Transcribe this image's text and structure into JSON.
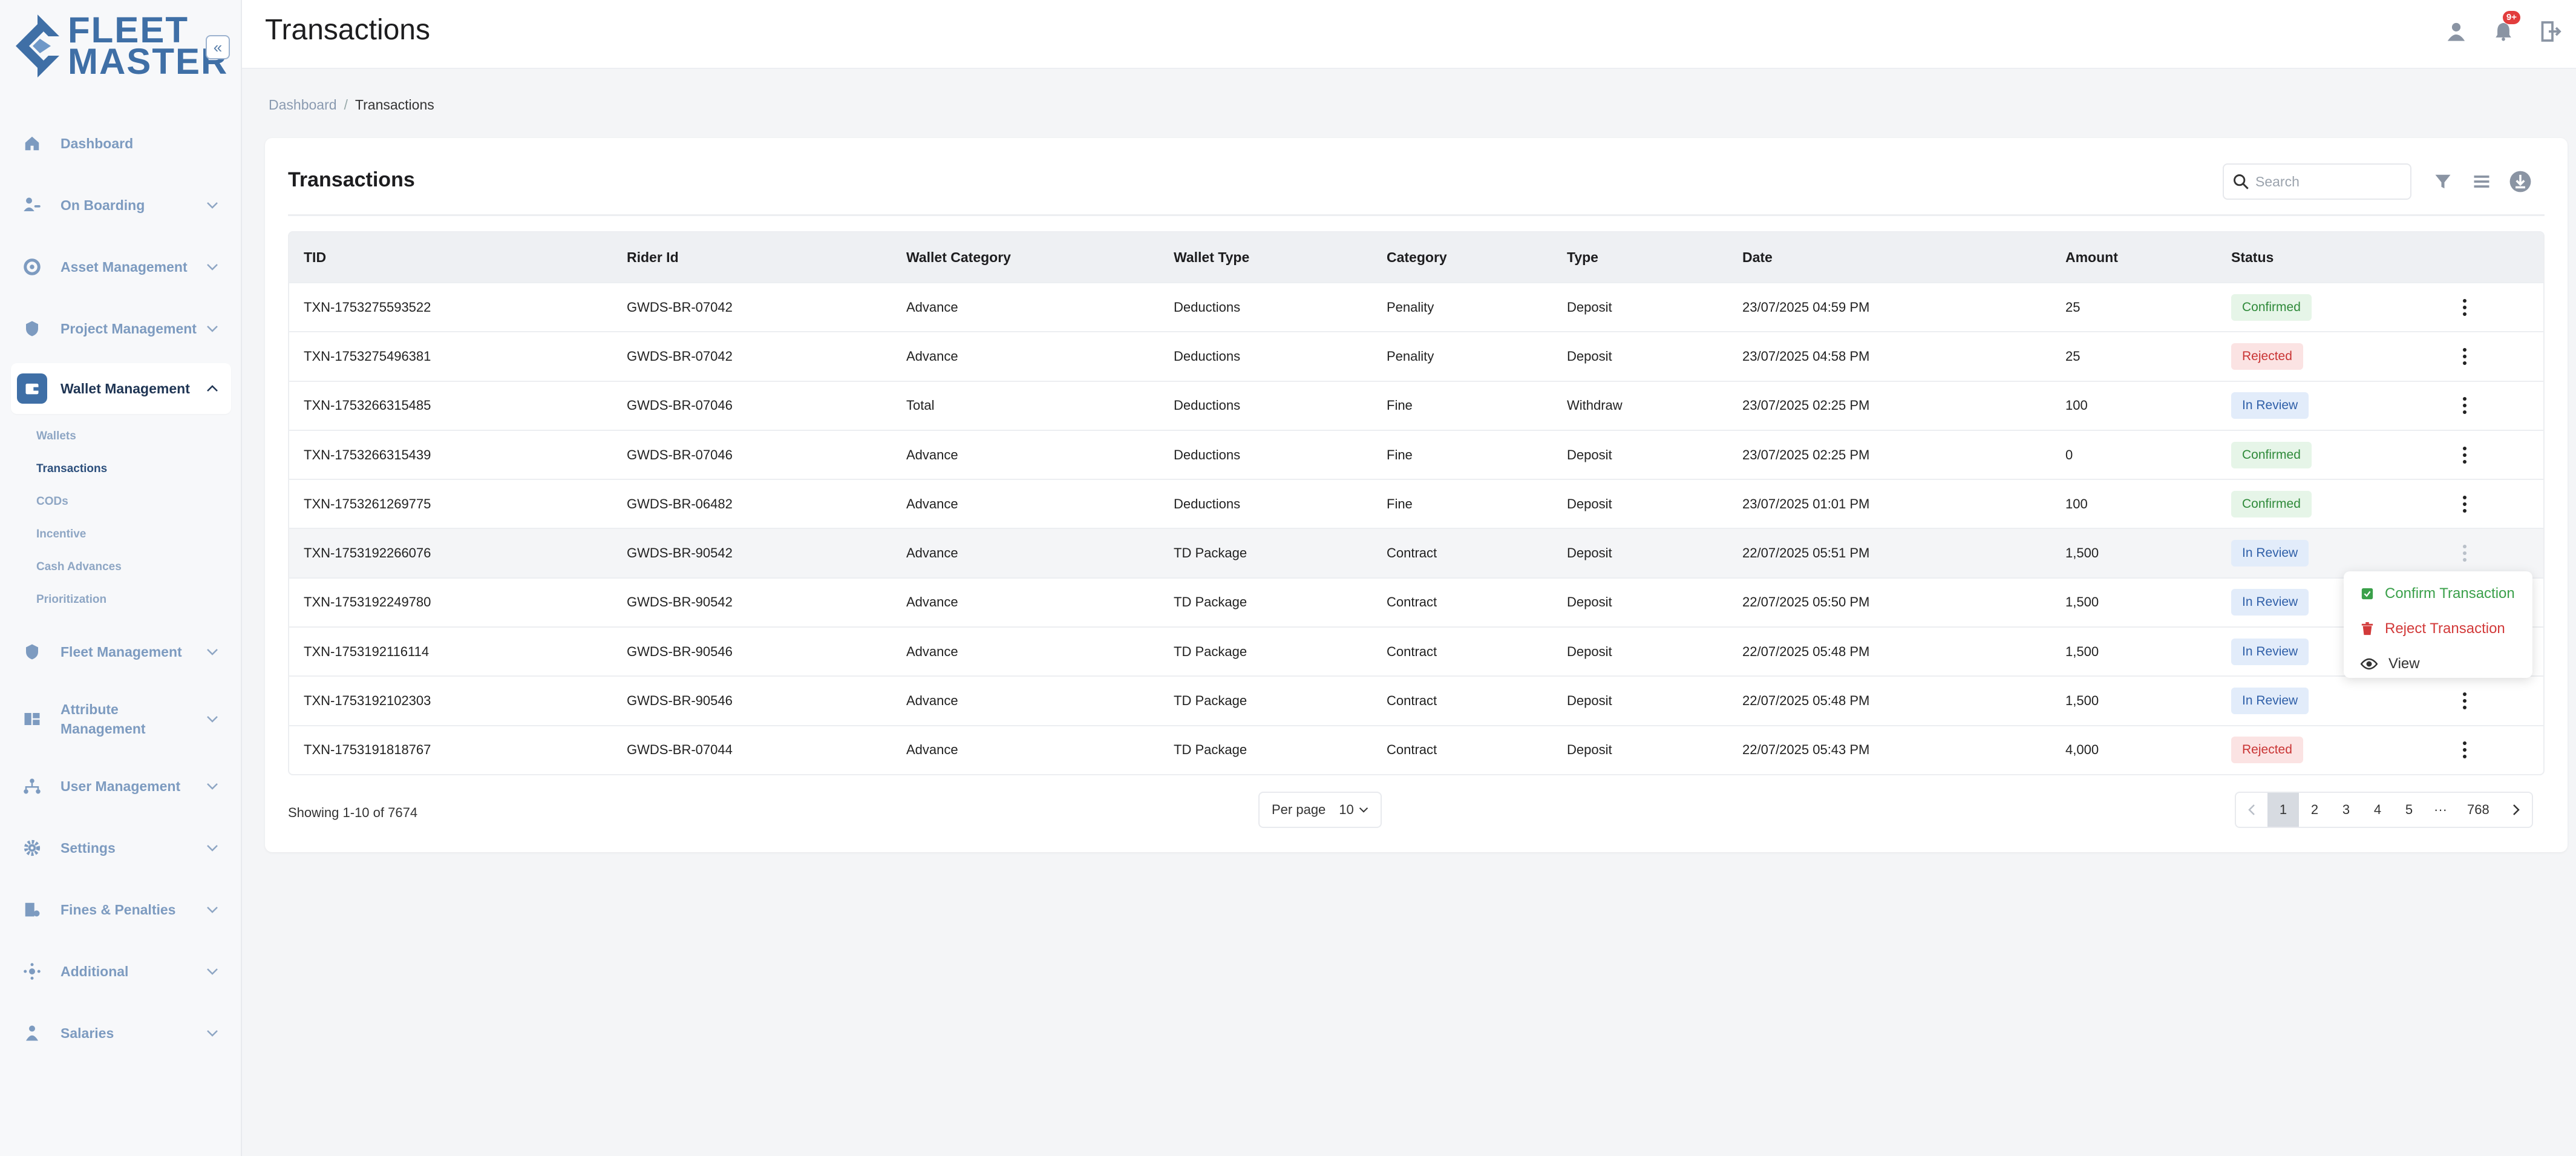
{
  "brand": {
    "line1": "FLEET",
    "line2": "MASTER"
  },
  "sidebar": {
    "collapse_glyph": "«",
    "items": [
      {
        "label": "Dashboard",
        "icon": "home-icon"
      },
      {
        "label": "On Boarding",
        "icon": "onboarding-icon"
      },
      {
        "label": "Asset Management",
        "icon": "asset-icon"
      },
      {
        "label": "Project Management",
        "icon": "project-icon"
      },
      {
        "label": "Wallet Management",
        "icon": "wallet-icon",
        "expanded": true
      },
      {
        "label": "Fleet Management",
        "icon": "fleet-icon"
      },
      {
        "label": "Attribute Management",
        "icon": "attribute-icon"
      },
      {
        "label": "User Management",
        "icon": "users-icon"
      },
      {
        "label": "Settings",
        "icon": "gear-icon"
      },
      {
        "label": "Fines & Penalties",
        "icon": "fines-icon"
      },
      {
        "label": "Additional",
        "icon": "additional-icon"
      },
      {
        "label": "Salaries",
        "icon": "salaries-icon"
      }
    ],
    "wallet_sub": [
      "Wallets",
      "Transactions",
      "CODs",
      "Incentive",
      "Cash Advances",
      "Prioritization"
    ],
    "current_sub": "Transactions"
  },
  "header": {
    "title": "Transactions",
    "notification_badge": "9+"
  },
  "breadcrumb": {
    "parent": "Dashboard",
    "separator": "/",
    "current": "Transactions"
  },
  "card": {
    "title": "Transactions",
    "search_placeholder": "Search"
  },
  "table": {
    "headers": [
      "TID",
      "Rider Id",
      "Wallet Category",
      "Wallet Type",
      "Category",
      "Type",
      "Date",
      "Amount",
      "Status"
    ],
    "rows": [
      [
        "TXN-1753275593522",
        "GWDS-BR-07042",
        "Advance",
        "Deductions",
        "Penality",
        "Deposit",
        "23/07/2025 04:59 PM",
        "25",
        "Confirmed"
      ],
      [
        "TXN-1753275496381",
        "GWDS-BR-07042",
        "Advance",
        "Deductions",
        "Penality",
        "Deposit",
        "23/07/2025 04:58 PM",
        "25",
        "Rejected"
      ],
      [
        "TXN-1753266315485",
        "GWDS-BR-07046",
        "Total",
        "Deductions",
        "Fine",
        "Withdraw",
        "23/07/2025 02:25 PM",
        "100",
        "In Review"
      ],
      [
        "TXN-1753266315439",
        "GWDS-BR-07046",
        "Advance",
        "Deductions",
        "Fine",
        "Deposit",
        "23/07/2025 02:25 PM",
        "0",
        "Confirmed"
      ],
      [
        "TXN-1753261269775",
        "GWDS-BR-06482",
        "Advance",
        "Deductions",
        "Fine",
        "Deposit",
        "23/07/2025 01:01 PM",
        "100",
        "Confirmed"
      ],
      [
        "TXN-1753192266076",
        "GWDS-BR-90542",
        "Advance",
        "TD Package",
        "Contract",
        "Deposit",
        "22/07/2025 05:51 PM",
        "1,500",
        "In Review"
      ],
      [
        "TXN-1753192249780",
        "GWDS-BR-90542",
        "Advance",
        "TD Package",
        "Contract",
        "Deposit",
        "22/07/2025 05:50 PM",
        "1,500",
        "In Review"
      ],
      [
        "TXN-1753192116114",
        "GWDS-BR-90546",
        "Advance",
        "TD Package",
        "Contract",
        "Deposit",
        "22/07/2025 05:48 PM",
        "1,500",
        "In Review"
      ],
      [
        "TXN-1753192102303",
        "GWDS-BR-90546",
        "Advance",
        "TD Package",
        "Contract",
        "Deposit",
        "22/07/2025 05:48 PM",
        "1,500",
        "In Review"
      ],
      [
        "TXN-1753191818767",
        "GWDS-BR-07044",
        "Advance",
        "TD Package",
        "Contract",
        "Deposit",
        "22/07/2025 05:43 PM",
        "4,000",
        "Rejected"
      ]
    ],
    "highlighted_row": 5
  },
  "status_colors": {
    "Confirmed": "#2f8a3a",
    "Rejected": "#c93434",
    "In Review": "#2f5fa8"
  },
  "footer": {
    "showing": "Showing 1-10 of 7674",
    "per_page_label": "Per page",
    "per_page_value": "10",
    "pages": [
      "1",
      "2",
      "3",
      "4",
      "5",
      "···",
      "768"
    ],
    "current_page": "1"
  },
  "row_menu": {
    "confirm": "Confirm Transaction",
    "reject": "Reject Transaction",
    "view": "View"
  },
  "accent_color": "#3f6fa6"
}
